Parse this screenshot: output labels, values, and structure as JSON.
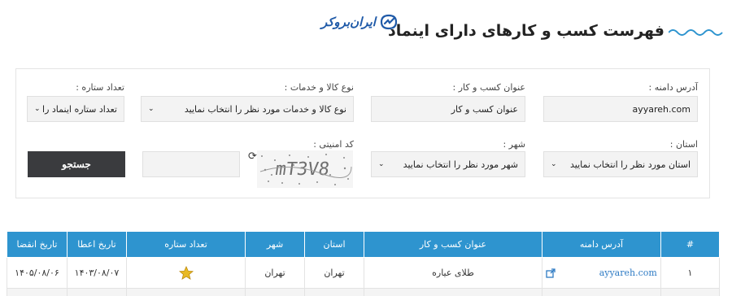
{
  "header": {
    "title": "فهرست کسب و کارهای دارای اینماد",
    "logo_text": "ایران‌بروکر"
  },
  "form": {
    "domain_label": "آدرس دامنه :",
    "domain_value": "ayyareh.com",
    "business_label": "عنوان کسب و کار :",
    "business_value": "عنوان کسب و کار",
    "goods_label": "نوع کالا و خدمات :",
    "goods_value": "نوع کالا و خدمات مورد نظر را انتخاب نمایید",
    "stars_label": "تعداد ستاره :",
    "stars_value": "تعداد ستاره اینماد را",
    "province_label": "استان :",
    "province_value": "استان مورد نظر را انتخاب نمایید",
    "city_label": "شهر :",
    "city_value": "شهر مورد نظر را انتخاب نمایید",
    "captcha_label": "کد امنیتی :",
    "captcha_text": "mT3V8",
    "search_button": "جستجو"
  },
  "table": {
    "headers": [
      "#",
      "آدرس دامنه",
      "عنوان کسب و کار",
      "استان",
      "شهر",
      "تعداد ستاره",
      "تاریخ اعطا",
      "تاریخ انقضا"
    ],
    "rows": [
      {
        "index": "۱",
        "domain": "ayyareh.com",
        "title": "طلای عیاره",
        "province": "تهران",
        "city": "تهران",
        "stars": 1,
        "issued": "۱۴۰۳/۰۸/۰۷",
        "expires": "۱۴۰۵/۰۸/۰۶"
      }
    ]
  },
  "colors": {
    "accent": "#2e94cf",
    "button": "#3a3b3e",
    "logo": "#1f5aa8",
    "star": "#e8b923"
  }
}
